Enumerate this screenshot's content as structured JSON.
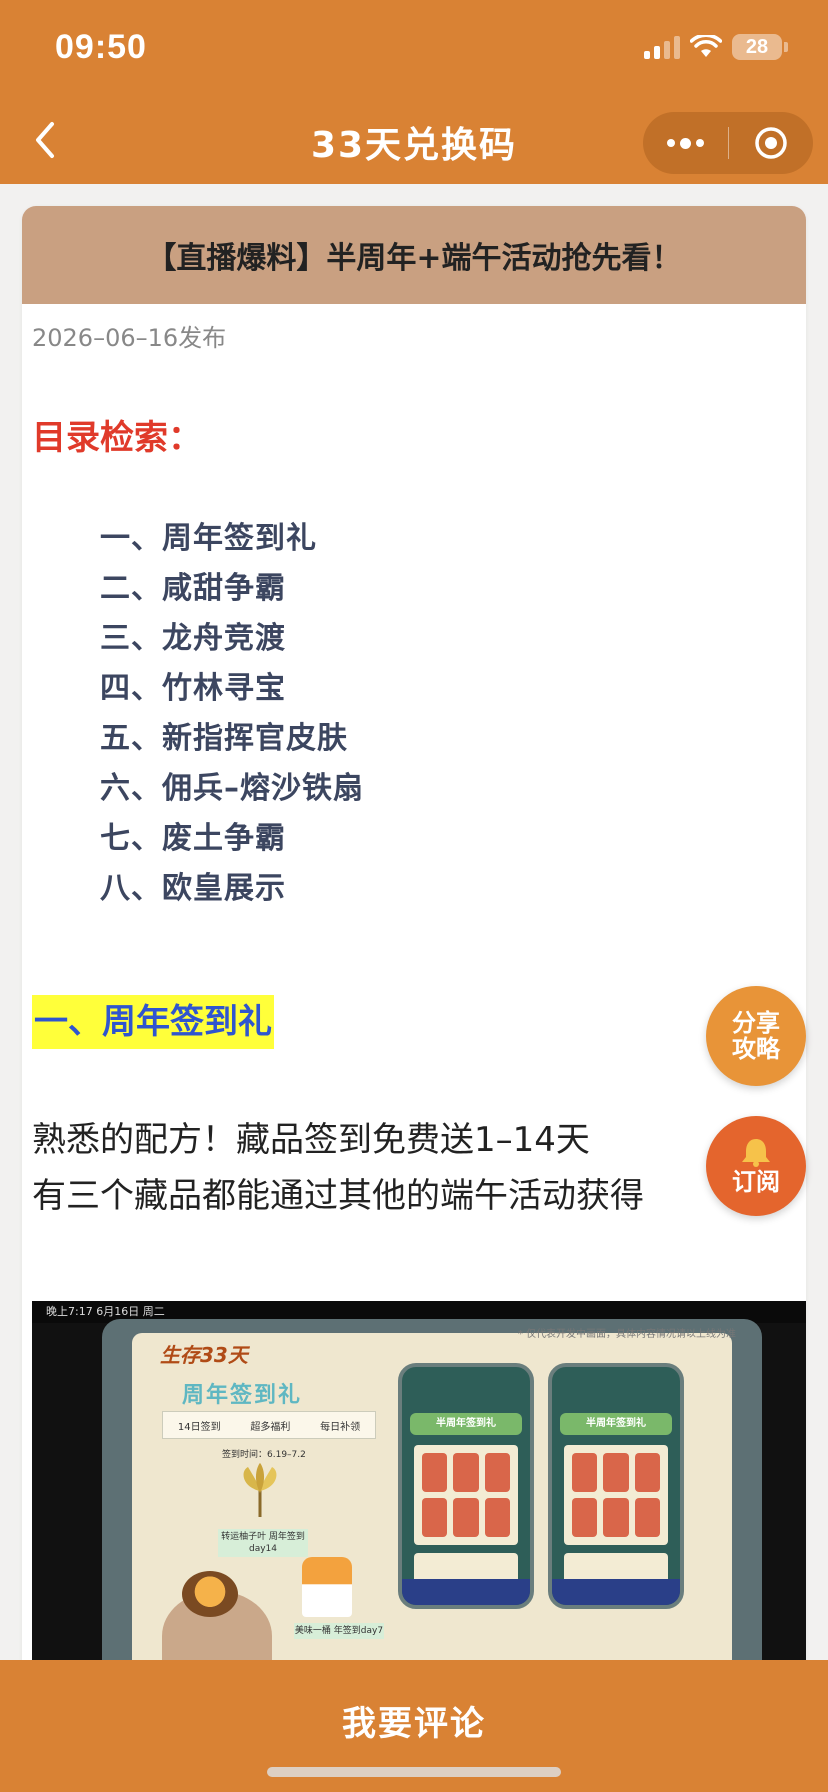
{
  "status": {
    "time": "09:50",
    "battery": "28"
  },
  "nav": {
    "title": "33天兑换码"
  },
  "article": {
    "header": "【直播爆料】半周年+端午活动抢先看！",
    "date": "2026–06–16发布",
    "toc_title": "目录检索：",
    "toc": [
      "一、周年签到礼",
      "二、咸甜争霸",
      "三、龙舟竞渡",
      "四、竹林寻宝",
      "五、新指挥官皮肤",
      "六、佣兵–熔沙铁扇",
      "七、废土争霸",
      "八、欧皇展示"
    ],
    "section1_title": "一、周年签到礼",
    "para1": "熟悉的配方！藏品签到免费送1–14天",
    "para2": "有三个藏品都能通过其他的端午活动获得",
    "image": {
      "statusbar": "晚上7:17 6月16日 周二",
      "note": "* 仅代表开发中画面，具体内容情况请以上线为准",
      "logo": "生存33天",
      "title": "周年签到礼",
      "tabs": [
        "14日签到",
        "超多福利",
        "每日补领"
      ],
      "time": "签到时间：6.19–7.2",
      "label1": "转运柚子叶 周年签到day14",
      "label2": "美味一桶 年签到day7",
      "phone_banner": "半周年签到礼"
    }
  },
  "fab": {
    "share_line1": "分享",
    "share_line2": "攻略",
    "subscribe": "订阅"
  },
  "bottom": {
    "comment": "我要评论"
  },
  "colors": {
    "brand": "#d98234",
    "header_bg": "#c9a081",
    "toc_red": "#e03a2a",
    "highlight": "#ffff3a",
    "section_blue": "#2f55cf"
  }
}
